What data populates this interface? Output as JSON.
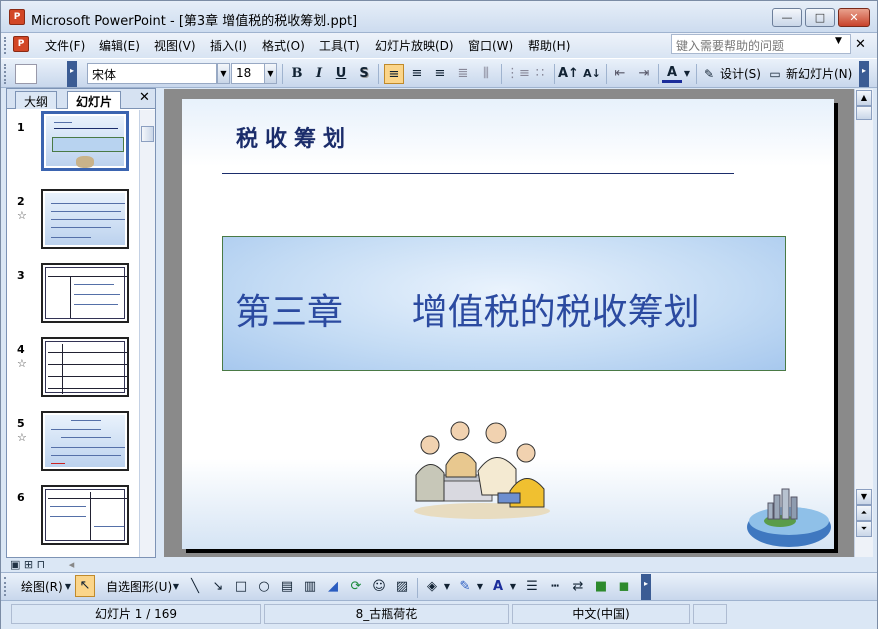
{
  "window": {
    "title": "Microsoft PowerPoint - [第3章 增值税的税收筹划.ppt]",
    "app_icon_text": "P",
    "minimize": "—",
    "maximize": "□",
    "close": "✕"
  },
  "menu": {
    "items": [
      "文件(F)",
      "编辑(E)",
      "视图(V)",
      "插入(I)",
      "格式(O)",
      "工具(T)",
      "幻灯片放映(D)",
      "窗口(W)",
      "帮助(H)"
    ],
    "help_placeholder": "键入需要帮助的问题",
    "close_glyph": "✕"
  },
  "toolbar": {
    "font_name": "宋体",
    "font_size": "18",
    "bold": "B",
    "italic": "I",
    "underline": "U",
    "shadow": "S",
    "design_label": "设计(S)",
    "new_slide_label": "新幻灯片(N)"
  },
  "left_panel": {
    "tabs": [
      "大纲",
      "幻灯片"
    ],
    "active_tab": "幻灯片",
    "close_glyph": "✕",
    "slides": [
      {
        "num": "1",
        "star": ""
      },
      {
        "num": "2",
        "star": "☆"
      },
      {
        "num": "3",
        "star": ""
      },
      {
        "num": "4",
        "star": "☆"
      },
      {
        "num": "5",
        "star": "☆"
      },
      {
        "num": "6",
        "star": ""
      }
    ]
  },
  "slide": {
    "title": "税收筹划",
    "chapter_text": "第三章      增值税的税收筹划"
  },
  "drawing_toolbar": {
    "draw_label": "绘图(R)",
    "autoshapes_label": "自选图形(U)"
  },
  "status": {
    "slide_position": "幻灯片 1 / 169",
    "design_template": "8_古瓶荷花",
    "language": "中文(中国)"
  },
  "colors": {
    "slide_title": "#1b2d6b",
    "chapter_text": "#2b4aa0",
    "accent": "#3b64b0"
  }
}
